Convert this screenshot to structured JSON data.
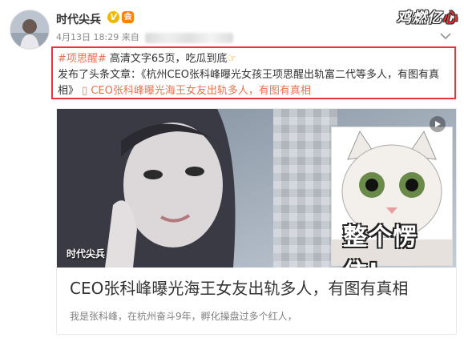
{
  "post": {
    "author": "时代尖兵",
    "verified_badge": "V",
    "member_badge": "会",
    "timestamp": "4月13日 18:29 来自",
    "hashtag": "#项思醒#",
    "line1_text": " 高清文字65页，吃瓜到底",
    "hand_emoji": "☞",
    "line2_text": "发布了头条文章：《杭州CEO张科峰曝光女孩王项思醒出轨富二代等多人，有图有真相》",
    "link_icon": "▯",
    "link_text": "CEO张科峰曝光海王女友出轨多人，有图有真相"
  },
  "brand_logo": {
    "text": "鸡燃亿",
    "heart": "心"
  },
  "card": {
    "image_caption": "整个愣住!",
    "watermark": "时代尖兵",
    "title": "CEO张科峰曝光海王女友出轨多人，有图有真相",
    "description": "我是张科峰，在杭州奋斗9年，孵化操盘过多个红人，"
  },
  "icons": [
    "chevron-down-icon",
    "play-icon",
    "link-icon"
  ],
  "colors": {
    "highlight_border": "#e8343a",
    "link": "#eb7350",
    "text": "#333333",
    "muted": "#808080"
  }
}
